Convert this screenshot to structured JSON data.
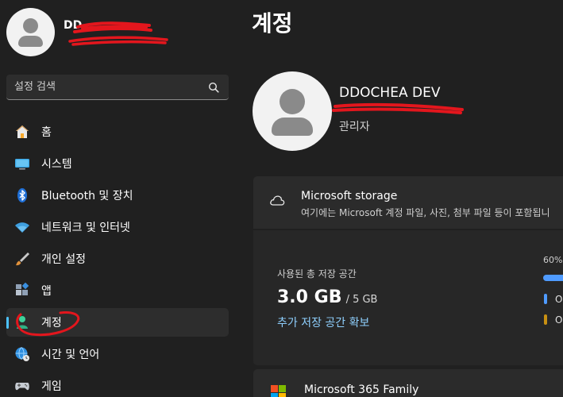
{
  "sidebar": {
    "user_name_visible": "DD",
    "search_placeholder": "설정 검색",
    "items": [
      {
        "label": "홈",
        "icon": "home-icon"
      },
      {
        "label": "시스템",
        "icon": "system-icon"
      },
      {
        "label": "Bluetooth 및 장치",
        "icon": "bluetooth-icon"
      },
      {
        "label": "네트워크 및 인터넷",
        "icon": "wifi-icon"
      },
      {
        "label": "개인 설정",
        "icon": "brush-icon"
      },
      {
        "label": "앱",
        "icon": "apps-icon"
      },
      {
        "label": "계정",
        "icon": "account-icon",
        "active": true
      },
      {
        "label": "시간 및 언어",
        "icon": "globe-clock-icon"
      },
      {
        "label": "게임",
        "icon": "gamepad-icon"
      }
    ]
  },
  "main": {
    "title": "계정",
    "account": {
      "name": "DDOCHEA DEV",
      "role": "관리자"
    },
    "storage": {
      "title": "Microsoft storage",
      "description": "여기에는 Microsoft 계정 파일, 사진, 첨부 파일 등이 포함됩니",
      "used_label": "사용된 총 저장 공간",
      "used_value": "3.0 GB",
      "total_value": "/ 5 GB",
      "add_link": "추가 저장 공간 확보",
      "percent_label": "60%",
      "percent_used": 60,
      "legend": [
        "O",
        "O"
      ]
    },
    "m365": {
      "title": "Microsoft 365 Family"
    }
  },
  "colors": {
    "background": "#202020",
    "accent": "#4cc2ff",
    "link": "#8fd0ff",
    "bar_blue": "#4f9bff",
    "legend_gold": "#c89012",
    "annotation_red": "#e3161d"
  }
}
